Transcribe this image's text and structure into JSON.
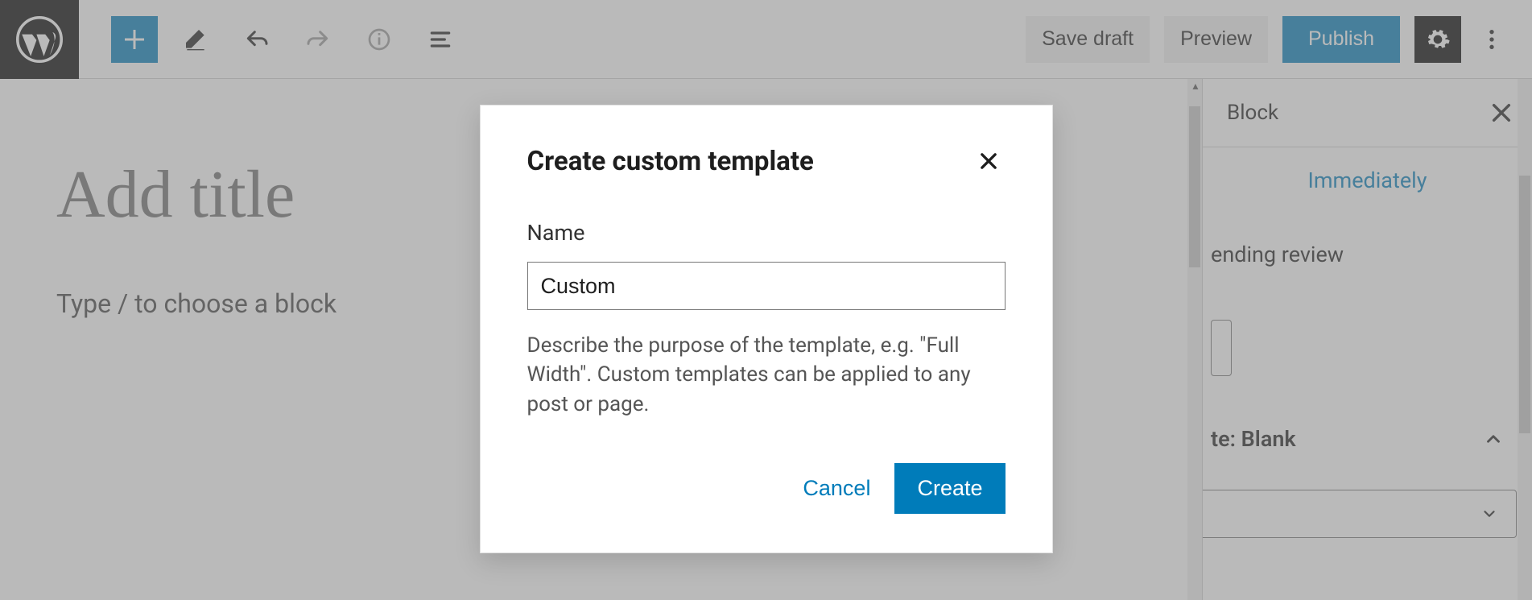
{
  "toolbar": {
    "save_draft": "Save draft",
    "preview": "Preview",
    "publish": "Publish"
  },
  "editor": {
    "title_placeholder": "Add title",
    "body_placeholder": "Type / to choose a block"
  },
  "sidebar": {
    "tab_block": "Block",
    "link_immediately": "Immediately",
    "pending_review_partial": "ending review",
    "template_title_partial": "te: Blank"
  },
  "modal": {
    "title": "Create custom template",
    "name_label": "Name",
    "name_value": "Custom",
    "hint": "Describe the purpose of the template, e.g. \"Full Width\". Custom templates can be applied to any post or page.",
    "cancel": "Cancel",
    "create": "Create"
  }
}
